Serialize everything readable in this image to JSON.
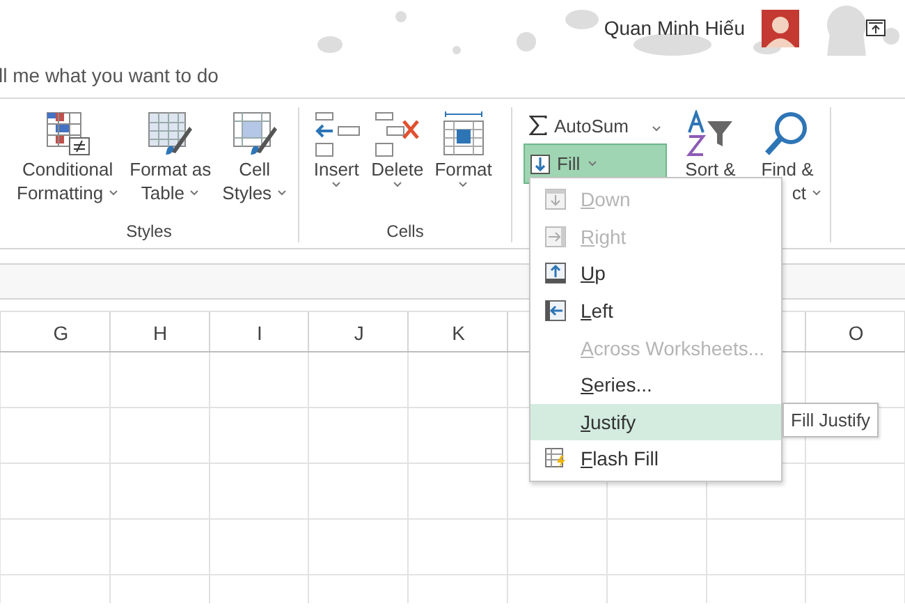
{
  "account": {
    "user_name": "Quan Minh Hiếu"
  },
  "tell_me": {
    "placeholder": "ll me what you want to do"
  },
  "ribbon_groups": [
    {
      "label": "Styles",
      "buttons": [
        {
          "kind": "conditional",
          "lines": [
            "Conditional",
            "Formatting"
          ],
          "dropdown": true
        },
        {
          "kind": "table",
          "lines": [
            "Format as",
            "Table"
          ],
          "dropdown": true
        },
        {
          "kind": "styles",
          "lines": [
            "Cell",
            "Styles"
          ],
          "dropdown": true
        }
      ]
    },
    {
      "label": "Cells",
      "buttons": [
        {
          "kind": "insert",
          "lines": [
            "Insert"
          ],
          "dropdown": true
        },
        {
          "kind": "delete",
          "lines": [
            "Delete"
          ],
          "dropdown": true
        },
        {
          "kind": "format",
          "lines": [
            "Format"
          ],
          "dropdown": true
        }
      ]
    }
  ],
  "editing": {
    "autosum": {
      "label": "AutoSum",
      "dropdown": true
    },
    "fill": {
      "label": "Fill",
      "expanded": true
    },
    "sort": {
      "lines": [
        "Sort &"
      ]
    },
    "find": {
      "lines": [
        "Find &",
        "ct"
      ],
      "dropdown": true
    }
  },
  "fill_menu": [
    {
      "label": "Down",
      "kind": "down",
      "disabled": true,
      "selected": false
    },
    {
      "label": "Right",
      "kind": "right",
      "disabled": true,
      "selected": false
    },
    {
      "label": "Up",
      "kind": "up",
      "disabled": false,
      "selected": false
    },
    {
      "label": "Left",
      "kind": "left",
      "disabled": false,
      "selected": false
    },
    {
      "label": "Across Worksheets...",
      "kind": "plain",
      "disabled": true,
      "selected": false
    },
    {
      "label": "Series...",
      "kind": "plain",
      "disabled": false,
      "selected": false
    },
    {
      "label": "Justify",
      "kind": "plain",
      "disabled": false,
      "selected": true
    },
    {
      "label": "Flash Fill",
      "kind": "flash",
      "disabled": false,
      "selected": false
    }
  ],
  "tooltip": {
    "text": "Fill Justify"
  },
  "sheet": {
    "columns": [
      "G",
      "H",
      "I",
      "J",
      "K",
      "O"
    ]
  }
}
